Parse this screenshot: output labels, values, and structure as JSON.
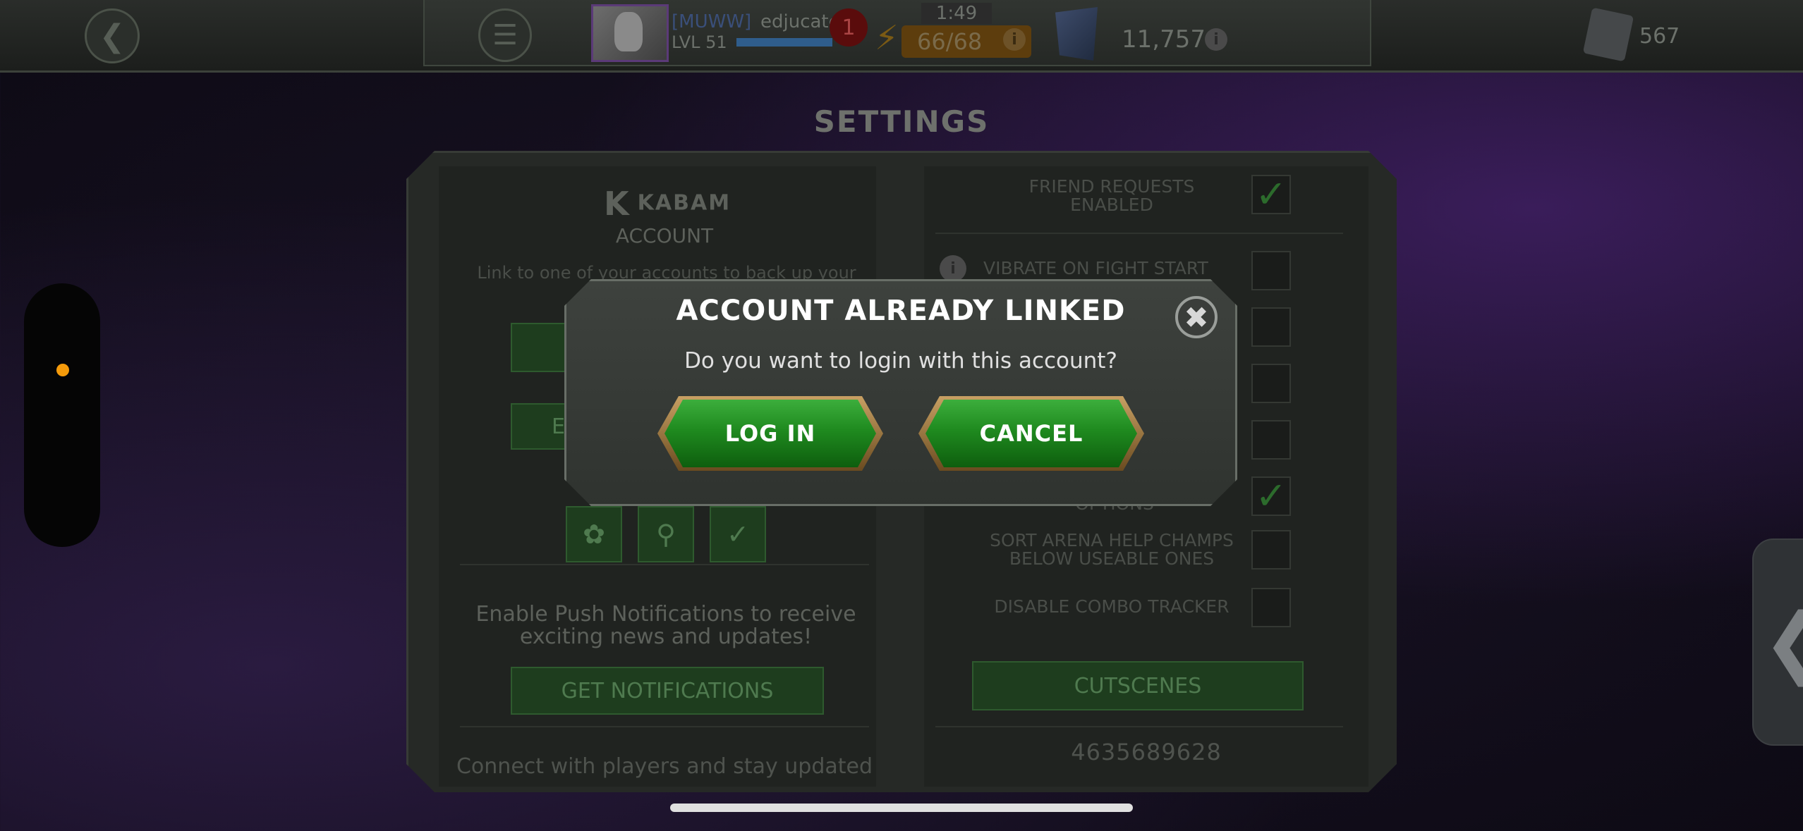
{
  "topbar": {
    "back_icon": "chevron-left-icon",
    "menu_icon": "hamburger-menu-icon",
    "alliance_tag": "[MUWW]",
    "player_name": "edjucate",
    "level": "LVL 51",
    "notification_count": "1",
    "timer": "1:49",
    "energy": "66/68",
    "units": "11,757",
    "crystals": "567"
  },
  "settings": {
    "title": "SETTINGS",
    "left": {
      "brand": "KABAM",
      "account_title": "ACCOUNT",
      "account_desc": "Link to one of your accounts to back up your saved data",
      "button_partial": "E",
      "push_text": "Enable Push Notifications to receive exciting news and updates!",
      "get_notifications": "GET NOTIFICATIONS",
      "connect_text": "Connect with players and stay updated"
    },
    "right": {
      "friend_requests": "FRIEND REQUESTS ENABLED",
      "vibrate": "VIBRATE ON FIGHT START",
      "partial_label": "OPTIONS",
      "sort_arena": "SORT ARENA HELP CHAMPS BELOW USEABLE ONES",
      "disable_combo": "DISABLE COMBO TRACKER",
      "cutscenes": "CUTSCENES",
      "player_id": "4635689628"
    }
  },
  "modal": {
    "title": "ACCOUNT ALREADY LINKED",
    "message": "Do you want to login with this account?",
    "login_label": "LOG IN",
    "cancel_label": "CANCEL",
    "close_icon": "close-icon"
  },
  "colors": {
    "accent_green": "#1f8a1f",
    "side_dot": "#f59b0b"
  }
}
